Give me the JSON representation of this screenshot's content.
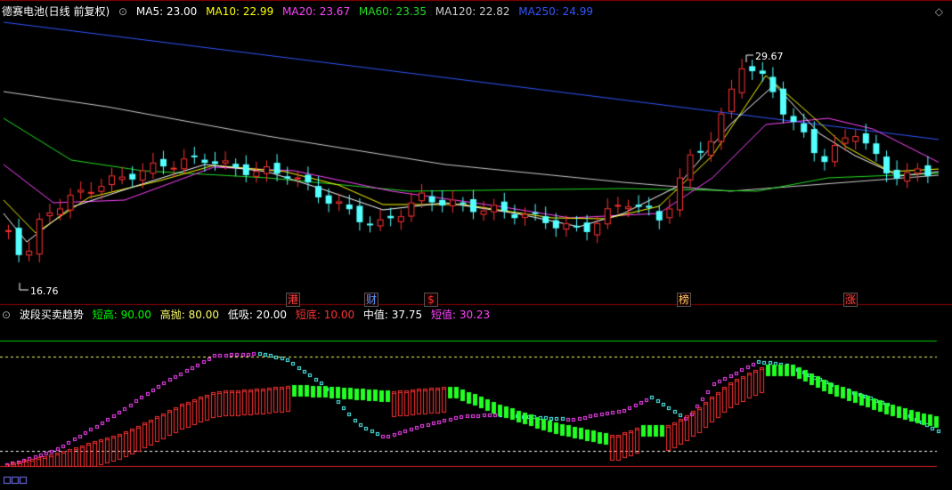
{
  "header": {
    "stock_title": "德赛电池(日线 前复权)",
    "ma": [
      {
        "label": "MA5: 23.00",
        "color": "#ffffff"
      },
      {
        "label": "MA10: 22.99",
        "color": "#ffff00"
      },
      {
        "label": "MA20: 23.67",
        "color": "#ff44ff"
      },
      {
        "label": "MA60: 23.35",
        "color": "#22dd22"
      },
      {
        "label": "MA120: 22.82",
        "color": "#cccccc"
      },
      {
        "label": "MA250: 24.99",
        "color": "#3355ff"
      }
    ]
  },
  "indicator": {
    "name": "波段买卖趋势",
    "params": [
      {
        "label": "短高: 90.00",
        "color": "#00ff00"
      },
      {
        "label": "高抛: 80.00",
        "color": "#ffff66"
      },
      {
        "label": "低吸: 20.00",
        "color": "#ffffff"
      },
      {
        "label": "短底: 10.00",
        "color": "#ff3333"
      },
      {
        "label": "中值: 37.75",
        "color": "#ffffff"
      },
      {
        "label": "短值: 30.23",
        "color": "#ff44ff"
      }
    ]
  },
  "price_labels": {
    "high": "29.67",
    "low": "16.76"
  },
  "markers": [
    {
      "char": "港",
      "color": "#ff4444"
    },
    {
      "char": "财",
      "color": "#5599ff"
    },
    {
      "char": "$",
      "color": "#ff3333"
    },
    {
      "char": "榜",
      "color": "#ffcc66"
    },
    {
      "char": "涨",
      "color": "#ff4444"
    }
  ],
  "colors": {
    "up": "#ff3232",
    "down": "#54ffff",
    "ma5": "#ffffff",
    "ma10": "#ffff00",
    "ma20": "#ff44ff",
    "ma60": "#22dd22",
    "ma120": "#cccccc",
    "ma250": "#3355ff"
  }
}
